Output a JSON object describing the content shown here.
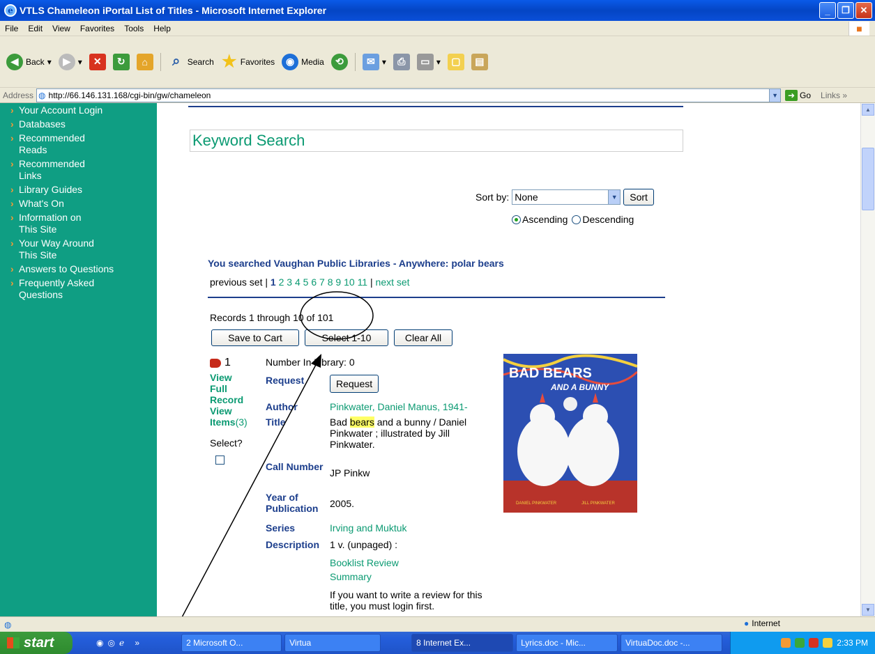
{
  "window": {
    "title": "VTLS Chameleon iPortal List of Titles - Microsoft Internet Explorer"
  },
  "menu": [
    "File",
    "Edit",
    "View",
    "Favorites",
    "Tools",
    "Help"
  ],
  "toolbar": {
    "back": "Back",
    "search": "Search",
    "favorites": "Favorites",
    "media": "Media"
  },
  "address": {
    "label": "Address",
    "url": "http://66.146.131.168/cgi-bin/gw/chameleon",
    "go": "Go",
    "links": "Links"
  },
  "sidebar": {
    "items": [
      "Your Account Login",
      "Databases",
      "Recommended\nReads",
      "Recommended\nLinks",
      "Library Guides",
      "What's On",
      "Information on\nThis Site",
      "Your Way Around\nThis Site",
      "Answers to Questions",
      "Frequently Asked\nQuestions"
    ]
  },
  "content": {
    "heading": "Keyword Search",
    "sort": {
      "label": "Sort by:",
      "value": "None",
      "button": "Sort",
      "asc": "Ascending",
      "desc": "Descending"
    },
    "searched": "You searched Vaughan Public Libraries - Anywhere: polar bears",
    "pager": {
      "prev": "previous set",
      "current": "1",
      "pages": [
        "2",
        "3",
        "4",
        "5",
        "6",
        "7",
        "8",
        "9",
        "10",
        "11"
      ],
      "next": "next set"
    },
    "records": "Records 1 through 10 of 101",
    "buttons": {
      "save": "Save to Cart",
      "select": "Select 1-10",
      "clear": "Clear All"
    },
    "result": {
      "num": "1",
      "view_full": "View Full Record",
      "view_items": "View Items",
      "items_count": "(3)",
      "select": "Select?",
      "number_label": "Number In Library: 0",
      "request_label": "Request",
      "request_button": "Request",
      "author_label": "Author",
      "author": "Pinkwater, Daniel Manus, 1941-",
      "title_label": "Title",
      "title_pre": "Bad ",
      "title_hl": "bears",
      "title_post": " and a bunny / Daniel Pinkwater ; illustrated by Jill Pinkwater.",
      "call_label": "Call Number",
      "call": "JP Pinkw",
      "year_label": "Year of Publication",
      "year": "2005.",
      "series_label": "Series",
      "series": "Irving and Muktuk",
      "desc_label": "Description",
      "desc": "1 v. (unpaged) :",
      "review": "Booklist Review",
      "summary": "Summary",
      "login_note": "If you want to write a review for this title, you must login first."
    },
    "cover": {
      "title1": "BAD BEARS",
      "title2": "AND A BUNNY",
      "author": "DANIEL PINKWATER",
      "illustrator": "JILL PINKWATER"
    }
  },
  "status": {
    "zone": "Internet"
  },
  "taskbar": {
    "start": "start",
    "tasks": [
      "2 Microsoft O...",
      "Virtua",
      "8 Internet Ex...",
      "Lyrics.doc - Mic...",
      "VirtuaDoc.doc -..."
    ],
    "clock": "2:33 PM"
  }
}
